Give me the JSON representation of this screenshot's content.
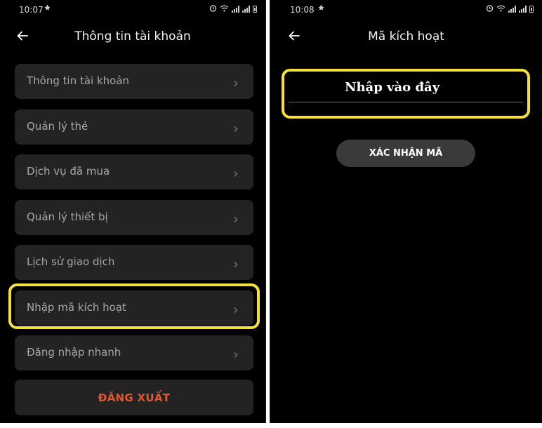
{
  "left_screen": {
    "status_time": "10:07",
    "header_title": "Thông tin tài khoản",
    "menu_items": [
      {
        "label": "Thông tin tài khoản"
      },
      {
        "label": "Quản lý thẻ"
      },
      {
        "label": "Dịch vụ đã mua"
      },
      {
        "label": "Quản lý thiết bị"
      },
      {
        "label": "Lịch sử giao dịch"
      },
      {
        "label": "Nhập mã kích hoạt"
      },
      {
        "label": "Đăng nhập nhanh"
      }
    ],
    "logout_label": "ĐĂNG XUẤT"
  },
  "right_screen": {
    "status_time": "10:08",
    "header_title": "Mã kích hoạt",
    "code_input": {
      "value": "",
      "placeholder": "Nhập vào đây"
    },
    "confirm_label": "XÁC NHẬN MÃ"
  },
  "colors": {
    "background": "#000000",
    "menu_item_bg": "#232323",
    "highlight": "#f2e13a",
    "logout_text": "#e2572f",
    "input_underline": "#c0552d",
    "confirm_button_bg": "#3a3a3a"
  },
  "icons": {
    "back": "back-arrow-icon",
    "chevron": "chevron-right-icon",
    "notification": "notification-icon",
    "alarm": "alarm-icon",
    "wifi": "wifi-icon",
    "signal": "signal-icon",
    "battery": "battery-icon"
  }
}
